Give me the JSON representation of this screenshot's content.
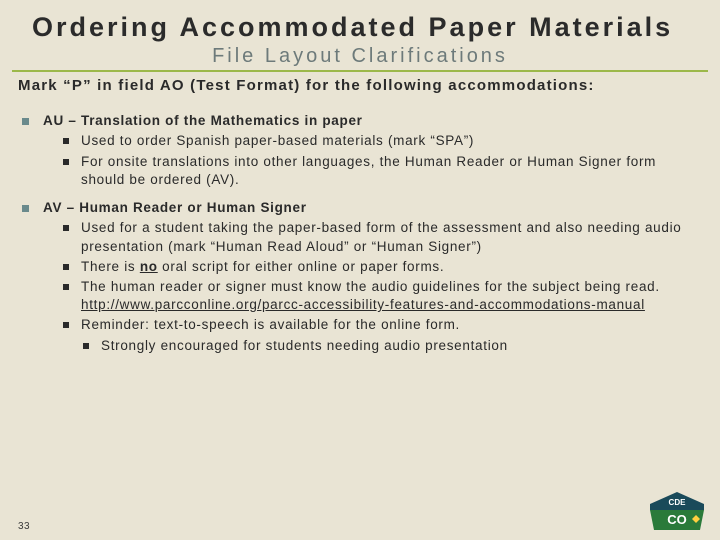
{
  "title": "Ordering Accommodated Paper Materials",
  "subtitle": "File Layout Clarifications",
  "intro": "Mark “P” in field AO (Test Format) for the following accommodations:",
  "sections": [
    {
      "head": "AU – Translation of the Mathematics in paper",
      "subs": [
        {
          "text": "Used to order Spanish paper-based materials (mark “SPA”)"
        },
        {
          "text": "For onsite translations into other languages, the Human Reader or Human Signer form should be ordered (AV)."
        }
      ]
    },
    {
      "head": "AV – Human Reader or Human Signer",
      "subs": [
        {
          "text": "Used for a student taking the paper-based form of the assessment and also needing audio presentation (mark “Human Read Aloud” or “Human Signer”)"
        },
        {
          "prefix": "There is ",
          "bold_underline": "no",
          "suffix": " oral script for either online or paper forms."
        },
        {
          "text": "The human reader or signer must know the audio guidelines for the subject being read. ",
          "link": "http://www.parcconline.org/parcc-accessibility-features-and-accommodations-manual"
        },
        {
          "text": "Reminder: text-to-speech is available for the online form."
        }
      ],
      "subs2": [
        {
          "text": "Strongly encouraged for students needing audio presentation"
        }
      ]
    }
  ],
  "page_num": "33",
  "logo": {
    "top_text": "CDE",
    "state": "CO"
  }
}
